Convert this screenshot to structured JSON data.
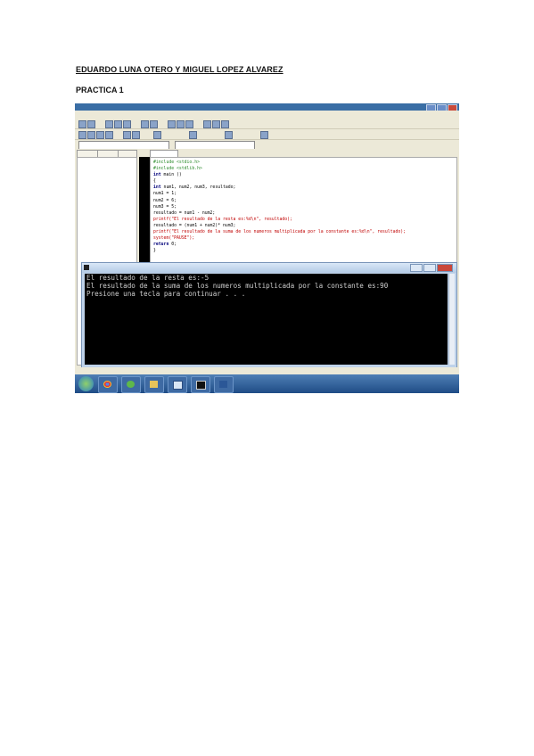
{
  "document": {
    "title": "EDUARDO LUNA OTERO Y MIGUEL LOPEZ ALVAREZ",
    "subtitle": "PRACTICA 1"
  },
  "console": {
    "lines": [
      "El resultado de la resta es:-5",
      "El resultado de la suma de los numeros multiplicada por la constante es:90",
      "Presione una tecla para continuar . . ."
    ]
  },
  "icons": {
    "window": [
      "minimize-icon",
      "maximize-icon",
      "close-icon"
    ],
    "taskbar": [
      "start-orb-icon",
      "chrome-icon",
      "app-icon",
      "folder-icon",
      "devcpp-icon",
      "console-icon",
      "word-icon"
    ]
  }
}
